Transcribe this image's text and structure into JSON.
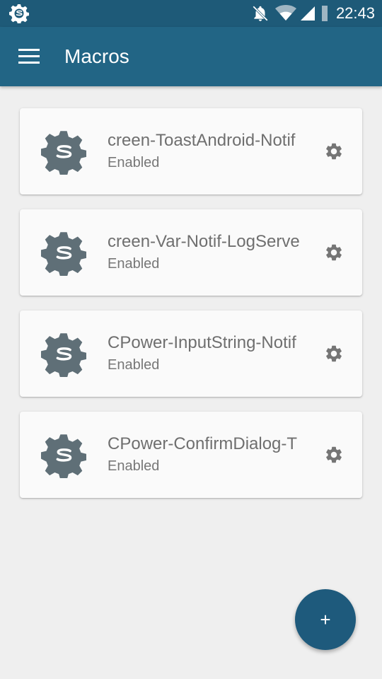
{
  "status_bar": {
    "time": "22:43",
    "icons": [
      "macrodroid-gear-icon",
      "notifications-off-icon",
      "wifi-icon",
      "cell-signal-icon",
      "battery-icon"
    ]
  },
  "app_bar": {
    "menu_icon": "hamburger-menu-icon",
    "title": "Macros"
  },
  "macros": [
    {
      "name": "creen-ToastAndroid-Notif",
      "status": "Enabled"
    },
    {
      "name": "creen-Var-Notif-LogServe",
      "status": "Enabled"
    },
    {
      "name": "CPower-InputString-Notif",
      "status": "Enabled"
    },
    {
      "name": "CPower-ConfirmDialog-T",
      "status": "Enabled"
    }
  ],
  "fab": {
    "label": "+"
  },
  "colors": {
    "status_bar": "#1e5a78",
    "app_bar": "#226585",
    "background": "#efefef",
    "card": "#fafafa",
    "macro_icon": "#5f6f77",
    "fab": "#1e5a7c"
  }
}
